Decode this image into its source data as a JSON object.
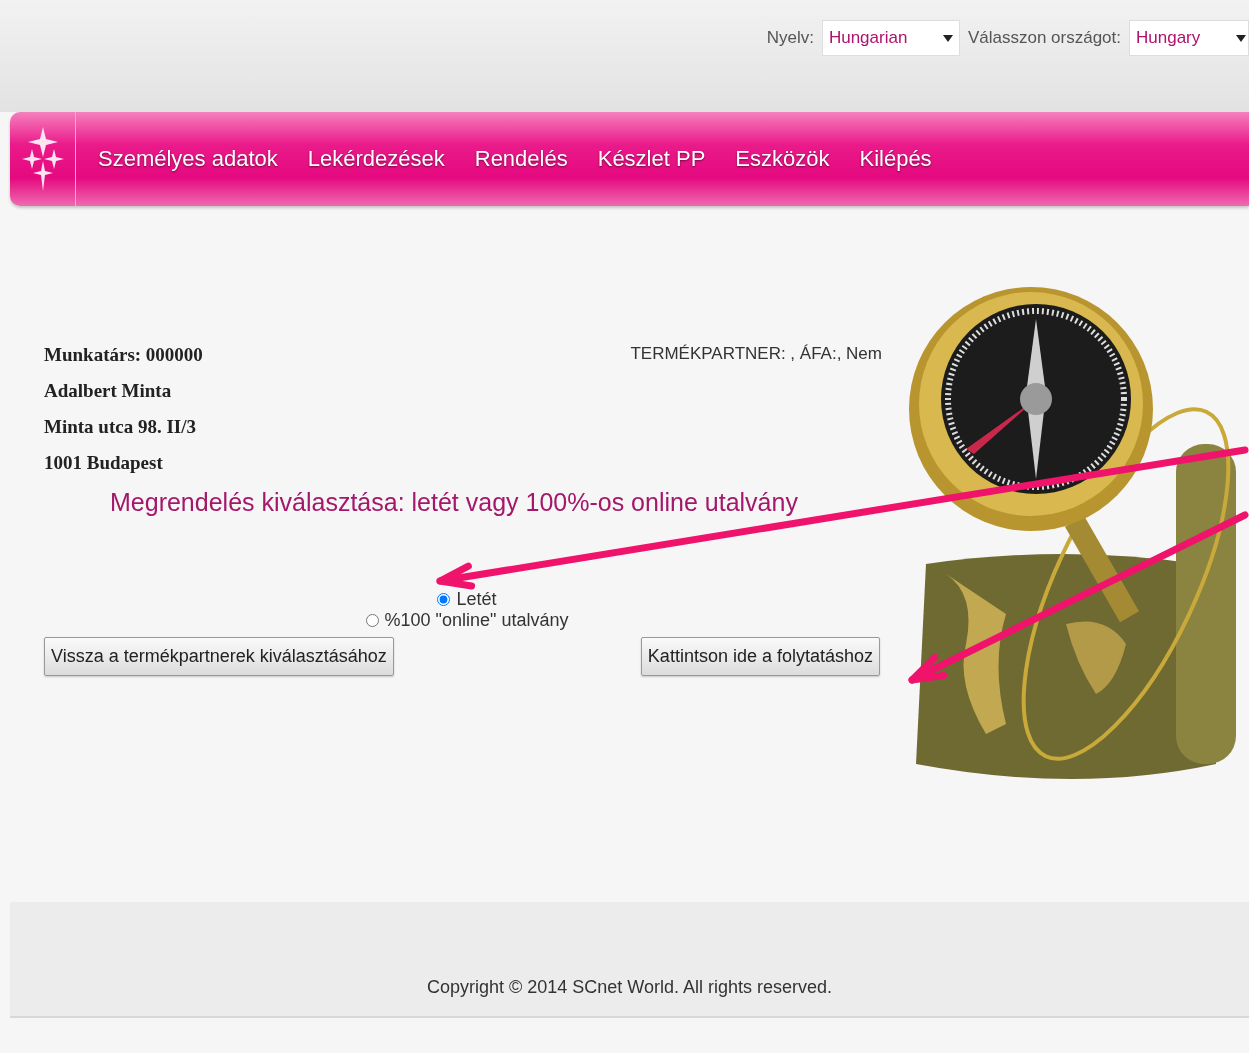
{
  "language": {
    "label": "Nyelv:",
    "value": "Hungarian"
  },
  "country": {
    "label": "Válasszon országot:",
    "value": "Hungary"
  },
  "nav": [
    "Személyes adatok",
    "Lekérdezések",
    "Rendelés",
    "Készlet PP",
    "Eszközök",
    "Kilépés"
  ],
  "employee": [
    "Munkatárs: 000000",
    "Adalbert Minta",
    "Minta utca 98. II/3",
    "1001 Budapest"
  ],
  "partner": "TERMÉKPARTNER: , ÁFA:, Nem",
  "heading": "Megrendelés kiválasztása: letét vagy 100%-os online utalvány",
  "options": [
    {
      "label": "Letét",
      "selected": true
    },
    {
      "label": "%100 \"online\" utalvány",
      "selected": false
    }
  ],
  "buttons": {
    "back": "Vissza a termékpartnerek kiválasztásához",
    "continue": "Kattintson ide a folytatáshoz"
  },
  "footer": "Copyright © 2014 SCnet World. All rights reserved."
}
